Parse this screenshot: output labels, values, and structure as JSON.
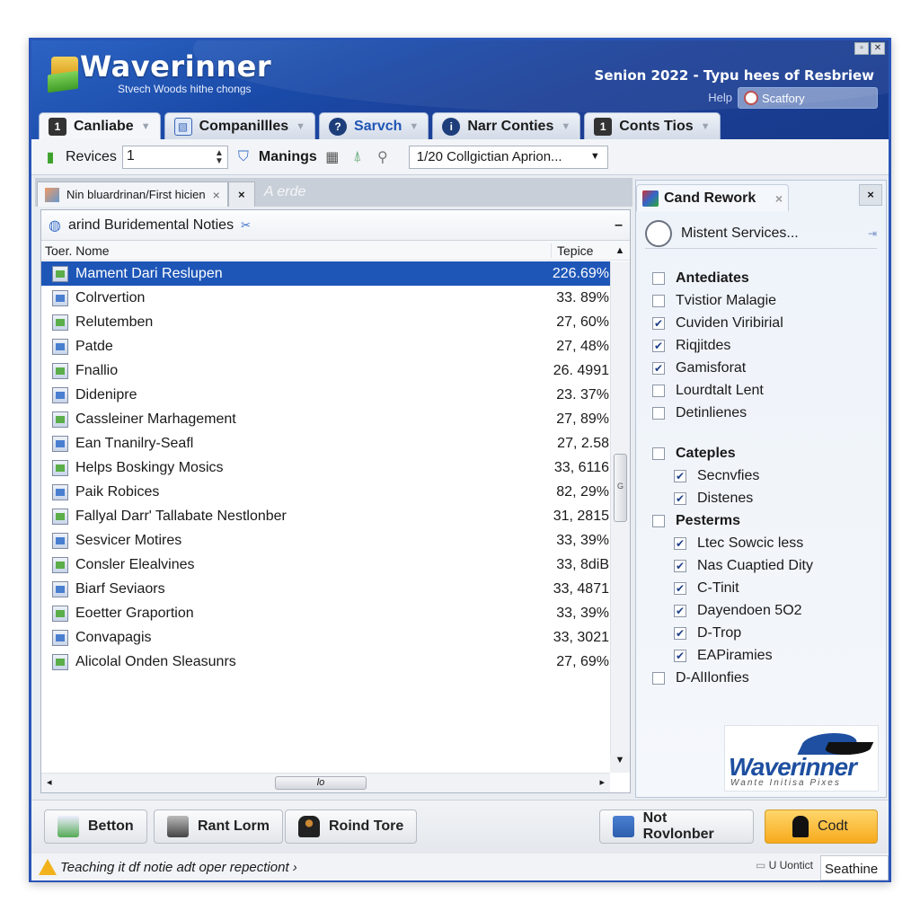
{
  "app": {
    "title": "Waverinner",
    "subtitle": "Stvech Woods hithe chongs",
    "header_title": "Senion 2022 - Typu hees of Resbriew",
    "help_label": "Help",
    "search_value": "Scatfory",
    "window_buttons": [
      "restore",
      "close"
    ]
  },
  "tabs": [
    {
      "label": "Canliabe",
      "icon": "user-badge-icon",
      "active": true
    },
    {
      "label": "Companillles",
      "icon": "image-icon",
      "active": false
    },
    {
      "label": "Sarvch",
      "icon": "help-circle-icon",
      "active": false
    },
    {
      "label": "Narr Conties",
      "icon": "info-circle-icon",
      "active": false
    },
    {
      "label": "Conts Tios",
      "icon": "user-badge-icon",
      "active": false
    }
  ],
  "toolbar": {
    "revices_label": "Revices",
    "revices_value": "1",
    "manings_label": "Manings",
    "dropdown_value": "1/20 Collgictian Aprion..."
  },
  "doc_tabs": {
    "active_label": "Nin bluardrinan/First hicien",
    "ghost_label": "A erde"
  },
  "list_panel": {
    "title": "arind Buridemental Noties",
    "col_name": "Toer. Nome",
    "col_value": "Tepice",
    "hscroll_label": "lo",
    "rows": [
      {
        "name": "Mament Dari Reslupen",
        "value": "226.69%",
        "selected": true
      },
      {
        "name": "Colrvertion",
        "value": "33. 89%"
      },
      {
        "name": "Relutemben",
        "value": "27, 60%"
      },
      {
        "name": "Patde",
        "value": "27, 48%"
      },
      {
        "name": "Fnallio",
        "value": "26. 4991"
      },
      {
        "name": "Didenipre",
        "value": "23. 37%"
      },
      {
        "name": "Cassleiner Marhagement",
        "value": "27, 89%"
      },
      {
        "name": "Ean Tnanilry-Seafl",
        "value": "27, 2.58"
      },
      {
        "name": "Helps Boskingy Mosics",
        "value": "33, 6116"
      },
      {
        "name": "Paik Robices",
        "value": "82, 29%"
      },
      {
        "name": "Fallyal Darr' Tallabate Nestlonber",
        "value": "31, 2815"
      },
      {
        "name": "Sesvicer Motires",
        "value": "33, 39%"
      },
      {
        "name": "Consler Elealvines",
        "value": "33, 8diB"
      },
      {
        "name": "Biarf Seviaors",
        "value": "33, 4871"
      },
      {
        "name": "Eoetter Graportion",
        "value": "33, 39%"
      },
      {
        "name": "Convapagis",
        "value": "33, 3021"
      },
      {
        "name": "Alicolal Onden Sleasunrs",
        "value": "27, 69%"
      }
    ]
  },
  "right_panel": {
    "tab_label": "Cand Rework",
    "search_text": "Mistent Services...",
    "items": [
      {
        "label": "Antediates",
        "checked": false,
        "bold": true
      },
      {
        "label": "Tvistior Malagie",
        "checked": false
      },
      {
        "label": "Cuviden Viribirial",
        "checked": true
      },
      {
        "label": "Riqjitdes",
        "checked": true
      },
      {
        "label": "Gamisforat",
        "checked": true
      },
      {
        "label": "Lourdtalt Lent",
        "checked": false
      },
      {
        "label": "Detinlienes",
        "checked": false
      },
      {
        "label": "Cateples",
        "checked": false,
        "bold": true,
        "gap": true
      },
      {
        "label": "Secnvfies",
        "checked": true,
        "indent": true
      },
      {
        "label": "Distenes",
        "checked": true,
        "indent": true
      },
      {
        "label": "Pesterms",
        "checked": false,
        "bold": true
      },
      {
        "label": "Ltec Sowcic less",
        "checked": true,
        "indent": true
      },
      {
        "label": "Nas Cuaptied Dity",
        "checked": true,
        "indent": true
      },
      {
        "label": "C-Tinit",
        "checked": true,
        "indent": true
      },
      {
        "label": "Dayendoen 5O2",
        "checked": true,
        "indent": true
      },
      {
        "label": "D-Trop",
        "checked": true,
        "indent": true
      },
      {
        "label": "EAPiramies",
        "checked": true,
        "indent": true
      },
      {
        "label": "D-AlIlonfies",
        "checked": false
      }
    ],
    "logo_name": "Waverinner",
    "logo_tagline": "Wante Initisa Pixes"
  },
  "buttons": {
    "betton": "Betton",
    "rant_lorm": "Rant Lorm",
    "roind_tore": "Roind Tore",
    "not_rovlonber": "Not Rovlonber",
    "codt": "Codt"
  },
  "status": {
    "message": "Teaching it df notie adt oper repectiont ›",
    "right_label": "U Uontict",
    "right_box": "Seathine"
  },
  "colors": {
    "header_blue": "#1a4aa8",
    "selection_blue": "#1e56b8",
    "primary_orange": "#f7aa1c"
  }
}
